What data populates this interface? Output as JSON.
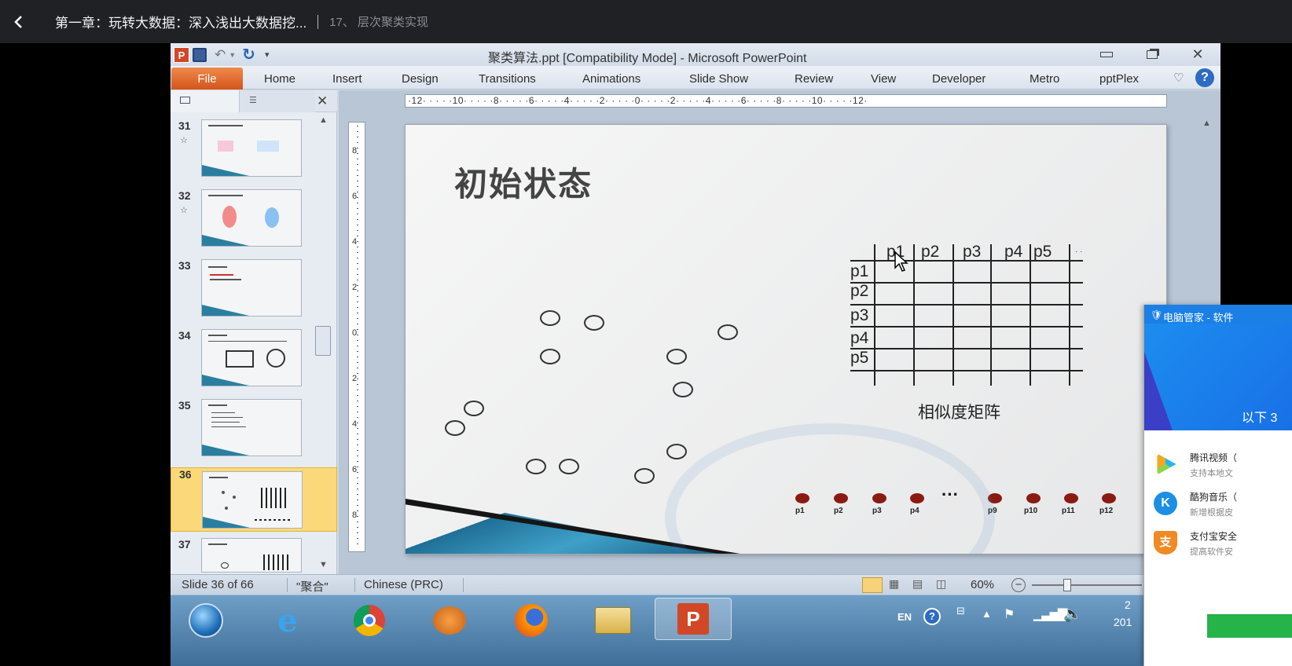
{
  "player": {
    "course_title": "第一章：玩转大数据：深入浅出大数据挖...",
    "lesson_title": "17、 层次聚类实现"
  },
  "window": {
    "title": "聚类算法.ppt [Compatibility Mode] - Microsoft PowerPoint",
    "app_icon": "P"
  },
  "ribbon": {
    "file_tab": "File",
    "tabs": [
      "Home",
      "Insert",
      "Design",
      "Transitions",
      "Animations",
      "Slide Show",
      "Review",
      "View",
      "Developer",
      "Metro",
      "pptPlex"
    ]
  },
  "ruler": {
    "horizontal": "·12· · · · ·10· · · · ·8· · · · ·6· · · · ·4· · · · ·2· · · · ·0· · · · ·2· · · · ·4· · · · ·6· · · · ·8· · · · ·10· · · · ·12·",
    "vertical": [
      "8",
      "6",
      "4",
      "2",
      "0",
      "2",
      "4",
      "6",
      "8"
    ]
  },
  "thumbnails": [
    {
      "num": "31",
      "star": "☆"
    },
    {
      "num": "32",
      "star": "☆"
    },
    {
      "num": "33",
      "star": ""
    },
    {
      "num": "34",
      "star": ""
    },
    {
      "num": "35",
      "star": ""
    },
    {
      "num": "36",
      "star": ""
    },
    {
      "num": "37",
      "star": ""
    }
  ],
  "slide": {
    "title": "初始状态",
    "matrix_cols": [
      "p1",
      "p2",
      "p3",
      "p4",
      "p5"
    ],
    "matrix_rows": [
      "p1",
      "p2",
      "p3",
      "p4",
      "p5"
    ],
    "matrix_caption": "相似度矩阵",
    "trailing_dots": "· · ·",
    "dot_labels": [
      "p1",
      "p2",
      "p3",
      "p4",
      "p9",
      "p10",
      "p11",
      "p12"
    ],
    "ellipsis": "···"
  },
  "status": {
    "slide_info": "Slide 36 of 66",
    "theme": "\"聚合\"",
    "language": "Chinese (PRC)",
    "zoom": "60%"
  },
  "taskbar": {
    "lang": "EN",
    "clock_partial": "2",
    "date_partial": "201"
  },
  "popup": {
    "header": "电脑管家 - 软件",
    "subtitle": "以下 3",
    "items": [
      {
        "name": "腾讯视频（",
        "desc": "支持本地文"
      },
      {
        "name": "酷狗音乐（",
        "desc": "新增根据皮"
      },
      {
        "name": "支付宝安全",
        "desc": "提高软件安"
      }
    ]
  }
}
